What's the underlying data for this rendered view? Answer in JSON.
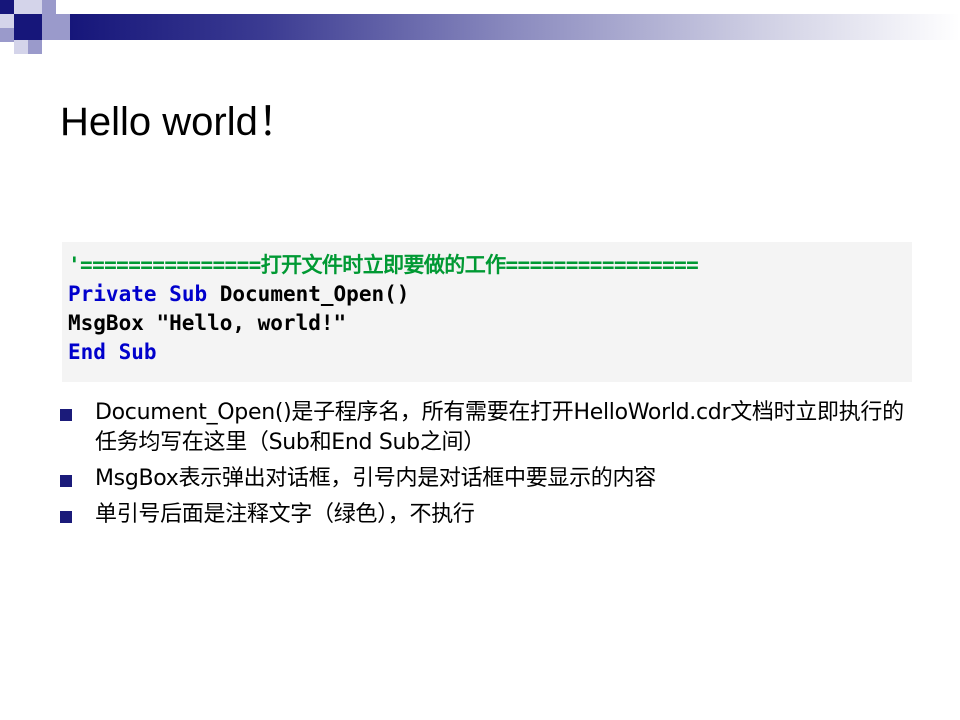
{
  "slide": {
    "title": "Hello world！",
    "colors": {
      "bar_dark": "#16167a",
      "bar_light": "#ffffff",
      "square_dark": "#16167a",
      "square_mid": "#9a9acb",
      "square_light": "#d4d4ea",
      "code_comment": "#009933",
      "code_keyword": "#0000cc",
      "bullet_marker": "#1b1b7a"
    }
  },
  "code": {
    "comment_line": "'===============打开文件时立即要做的工作================",
    "line2_kw1": "Private",
    "line2_kw2": "Sub",
    "line2_rest": " Document_Open()",
    "line3": "MsgBox \"Hello, world!\"",
    "line4_kw1": "End",
    "line4_kw2": "Sub"
  },
  "bullets": [
    {
      "text": "Document_Open()是子程序名，所有需要在打开HelloWorld.cdr文档时立即执行的任务均写在这里（Sub和End Sub之间）"
    },
    {
      "text": "MsgBox表示弹出对话框，引号内是对话框中要显示的内容"
    },
    {
      "text": "单引号后面是注释文字（绿色），不执行"
    }
  ]
}
